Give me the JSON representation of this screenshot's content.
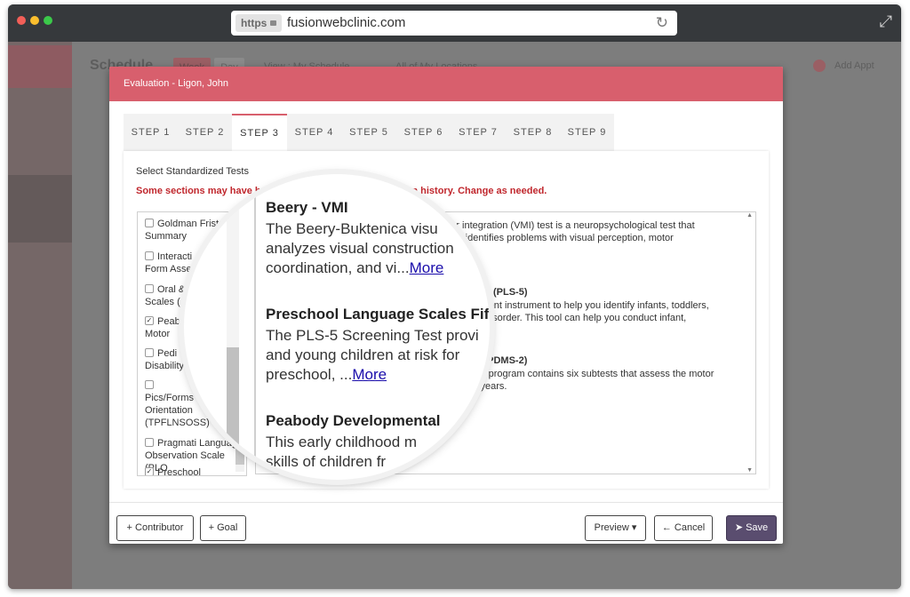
{
  "browser": {
    "protocol": "https",
    "url": "fusionwebclinic.com"
  },
  "background": {
    "title": "Schedule",
    "week_label": "Week",
    "day_label": "Day",
    "view_label": "View : My Schedule",
    "location_label": "All of My Locations",
    "add_label": "Add Appt"
  },
  "modal": {
    "title": "Evaluation - Ligon, John",
    "tabs": [
      {
        "label": "STEP 1"
      },
      {
        "label": "STEP 2"
      },
      {
        "label": "STEP 3",
        "active": true
      },
      {
        "label": "STEP 4"
      },
      {
        "label": "STEP 5"
      },
      {
        "label": "STEP 6"
      },
      {
        "label": "STEP 7"
      },
      {
        "label": "STEP 8"
      },
      {
        "label": "STEP 9"
      }
    ],
    "section_title": "Select Standardized Tests",
    "warning_start": "Some sections may have b",
    "warning_end": "ur evaluation history. Change as needed.",
    "tests": [
      {
        "label": "Goldman Frist",
        "label2": "Summary",
        "checked": false
      },
      {
        "label": "Interacti",
        "label2": "Form Asse",
        "checked": false
      },
      {
        "label": "Oral &",
        "label2": "Scales (",
        "checked": false
      },
      {
        "label": "Peab",
        "label2": "Motor",
        "checked": true
      },
      {
        "label": "Pedi",
        "label2": "Disability",
        "checked": false
      },
      {
        "label": "",
        "label2": "Pics/Forms",
        "label3": "Orientation",
        "label4": "(TPFLNSOSS)",
        "checked": false
      },
      {
        "label": "Pragmati Languag",
        "label2": "Observation Scale (PLO",
        "checked": false
      },
      {
        "label": "Preschool Language Scales",
        "checked": true
      }
    ],
    "details": [
      {
        "title": "",
        "line1": "otor integration (VMI) test is a neuropsychological test that",
        "line2": "lls. It identifies problems with visual perception, motor"
      },
      {
        "title": "dition (PLS-5)",
        "line1": "n efficient instrument to help you identify infants, toddlers,",
        "line2": "uage disorder. This tool can help you conduct infant,"
      },
      {
        "title": "ales (PDMS-2)",
        "line1": "pment program contains six subtests that assess the motor",
        "line2": "gh 5 years."
      }
    ],
    "buttons": {
      "contributor": "+ Contributor",
      "goal": "+ Goal",
      "preview": "Preview",
      "cancel": "Cancel",
      "save": "Save"
    }
  },
  "lens": {
    "blocks": [
      {
        "title": "Beery - VMI",
        "line1": "The Beery-Buktenica visu",
        "line2": "analyzes visual construction",
        "line3": "coordination, and vi...",
        "more": "More"
      },
      {
        "title": "Preschool Language Scales Fif",
        "line1": "The PLS-5 Screening Test provi",
        "line2": "and young children at risk for",
        "line3": "preschool, ...",
        "more": "More"
      },
      {
        "title": "Peabody Developmental",
        "line1": "This early childhood m",
        "line2": "skills of children fr"
      }
    ]
  }
}
